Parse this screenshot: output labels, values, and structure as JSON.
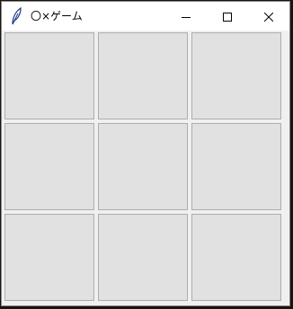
{
  "window": {
    "title": "〇×ゲーム",
    "icon": "feather-icon",
    "controls": {
      "minimize_icon": "minimize-icon",
      "maximize_icon": "maximize-icon",
      "close_icon": "close-icon"
    }
  },
  "board": {
    "rows": 3,
    "cols": 3,
    "cells": [
      "",
      "",
      "",
      "",
      "",
      "",
      "",
      "",
      ""
    ]
  },
  "colors": {
    "cell_bg": "#e1e1e1",
    "cell_border": "#adadad",
    "window_bg": "#f0f0f0",
    "titlebar_bg": "#ffffff"
  }
}
